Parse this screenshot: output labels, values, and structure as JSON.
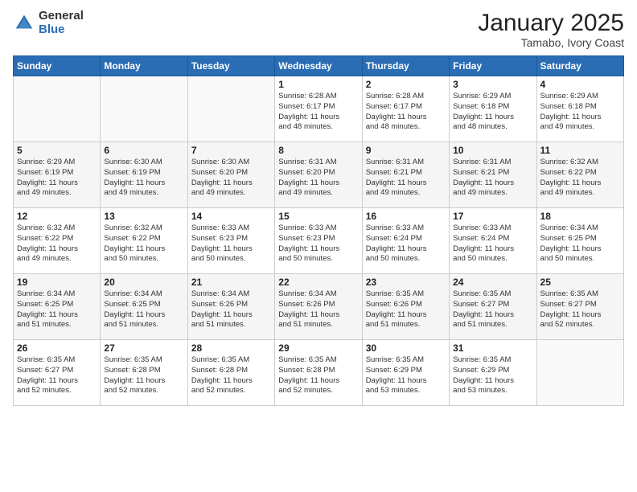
{
  "logo": {
    "general": "General",
    "blue": "Blue"
  },
  "title": "January 2025",
  "subtitle": "Tamabo, Ivory Coast",
  "days_header": [
    "Sunday",
    "Monday",
    "Tuesday",
    "Wednesday",
    "Thursday",
    "Friday",
    "Saturday"
  ],
  "weeks": [
    [
      {
        "num": "",
        "info": ""
      },
      {
        "num": "",
        "info": ""
      },
      {
        "num": "",
        "info": ""
      },
      {
        "num": "1",
        "info": "Sunrise: 6:28 AM\nSunset: 6:17 PM\nDaylight: 11 hours\nand 48 minutes."
      },
      {
        "num": "2",
        "info": "Sunrise: 6:28 AM\nSunset: 6:17 PM\nDaylight: 11 hours\nand 48 minutes."
      },
      {
        "num": "3",
        "info": "Sunrise: 6:29 AM\nSunset: 6:18 PM\nDaylight: 11 hours\nand 48 minutes."
      },
      {
        "num": "4",
        "info": "Sunrise: 6:29 AM\nSunset: 6:18 PM\nDaylight: 11 hours\nand 49 minutes."
      }
    ],
    [
      {
        "num": "5",
        "info": "Sunrise: 6:29 AM\nSunset: 6:19 PM\nDaylight: 11 hours\nand 49 minutes."
      },
      {
        "num": "6",
        "info": "Sunrise: 6:30 AM\nSunset: 6:19 PM\nDaylight: 11 hours\nand 49 minutes."
      },
      {
        "num": "7",
        "info": "Sunrise: 6:30 AM\nSunset: 6:20 PM\nDaylight: 11 hours\nand 49 minutes."
      },
      {
        "num": "8",
        "info": "Sunrise: 6:31 AM\nSunset: 6:20 PM\nDaylight: 11 hours\nand 49 minutes."
      },
      {
        "num": "9",
        "info": "Sunrise: 6:31 AM\nSunset: 6:21 PM\nDaylight: 11 hours\nand 49 minutes."
      },
      {
        "num": "10",
        "info": "Sunrise: 6:31 AM\nSunset: 6:21 PM\nDaylight: 11 hours\nand 49 minutes."
      },
      {
        "num": "11",
        "info": "Sunrise: 6:32 AM\nSunset: 6:22 PM\nDaylight: 11 hours\nand 49 minutes."
      }
    ],
    [
      {
        "num": "12",
        "info": "Sunrise: 6:32 AM\nSunset: 6:22 PM\nDaylight: 11 hours\nand 49 minutes."
      },
      {
        "num": "13",
        "info": "Sunrise: 6:32 AM\nSunset: 6:22 PM\nDaylight: 11 hours\nand 50 minutes."
      },
      {
        "num": "14",
        "info": "Sunrise: 6:33 AM\nSunset: 6:23 PM\nDaylight: 11 hours\nand 50 minutes."
      },
      {
        "num": "15",
        "info": "Sunrise: 6:33 AM\nSunset: 6:23 PM\nDaylight: 11 hours\nand 50 minutes."
      },
      {
        "num": "16",
        "info": "Sunrise: 6:33 AM\nSunset: 6:24 PM\nDaylight: 11 hours\nand 50 minutes."
      },
      {
        "num": "17",
        "info": "Sunrise: 6:33 AM\nSunset: 6:24 PM\nDaylight: 11 hours\nand 50 minutes."
      },
      {
        "num": "18",
        "info": "Sunrise: 6:34 AM\nSunset: 6:25 PM\nDaylight: 11 hours\nand 50 minutes."
      }
    ],
    [
      {
        "num": "19",
        "info": "Sunrise: 6:34 AM\nSunset: 6:25 PM\nDaylight: 11 hours\nand 51 minutes."
      },
      {
        "num": "20",
        "info": "Sunrise: 6:34 AM\nSunset: 6:25 PM\nDaylight: 11 hours\nand 51 minutes."
      },
      {
        "num": "21",
        "info": "Sunrise: 6:34 AM\nSunset: 6:26 PM\nDaylight: 11 hours\nand 51 minutes."
      },
      {
        "num": "22",
        "info": "Sunrise: 6:34 AM\nSunset: 6:26 PM\nDaylight: 11 hours\nand 51 minutes."
      },
      {
        "num": "23",
        "info": "Sunrise: 6:35 AM\nSunset: 6:26 PM\nDaylight: 11 hours\nand 51 minutes."
      },
      {
        "num": "24",
        "info": "Sunrise: 6:35 AM\nSunset: 6:27 PM\nDaylight: 11 hours\nand 51 minutes."
      },
      {
        "num": "25",
        "info": "Sunrise: 6:35 AM\nSunset: 6:27 PM\nDaylight: 11 hours\nand 52 minutes."
      }
    ],
    [
      {
        "num": "26",
        "info": "Sunrise: 6:35 AM\nSunset: 6:27 PM\nDaylight: 11 hours\nand 52 minutes."
      },
      {
        "num": "27",
        "info": "Sunrise: 6:35 AM\nSunset: 6:28 PM\nDaylight: 11 hours\nand 52 minutes."
      },
      {
        "num": "28",
        "info": "Sunrise: 6:35 AM\nSunset: 6:28 PM\nDaylight: 11 hours\nand 52 minutes."
      },
      {
        "num": "29",
        "info": "Sunrise: 6:35 AM\nSunset: 6:28 PM\nDaylight: 11 hours\nand 52 minutes."
      },
      {
        "num": "30",
        "info": "Sunrise: 6:35 AM\nSunset: 6:29 PM\nDaylight: 11 hours\nand 53 minutes."
      },
      {
        "num": "31",
        "info": "Sunrise: 6:35 AM\nSunset: 6:29 PM\nDaylight: 11 hours\nand 53 minutes."
      },
      {
        "num": "",
        "info": ""
      }
    ]
  ]
}
